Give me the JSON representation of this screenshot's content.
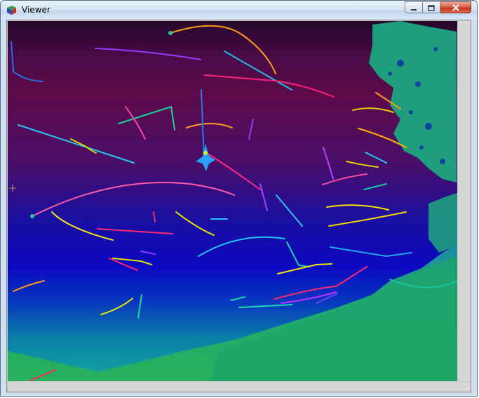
{
  "window": {
    "title": "Viewer"
  },
  "icons": {
    "app": "viewer-cube-icon",
    "minimize": "minimize-icon",
    "maximize": "maximize-icon",
    "close": "close-icon"
  },
  "colors": {
    "sky_top": "#25072a",
    "sky_mid": "#5d0a48",
    "sky_blue": "#0b07c0",
    "ground": "#1fa874",
    "tree": "#20a07a"
  }
}
